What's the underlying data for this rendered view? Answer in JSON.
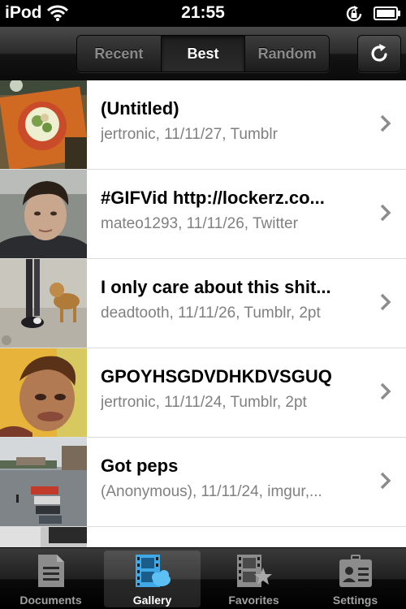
{
  "status_bar": {
    "carrier": "iPod",
    "time": "21:55"
  },
  "nav": {
    "segments": [
      "Recent",
      "Best",
      "Random"
    ],
    "selected_segment": "Best",
    "refresh_icon": "refresh-icon"
  },
  "list": {
    "rows": [
      {
        "title": "(Untitled)",
        "subtitle": "jertronic, 11/11/27, Tumblr",
        "thumb": "food-plate-photo"
      },
      {
        "title": "#GIFVid http://lockerz.co...",
        "subtitle": "mateo1293, 11/11/26, Twitter",
        "thumb": "face-photo"
      },
      {
        "title": "I only care about this shit...",
        "subtitle": "deadtooth, 11/11/26, Tumblr, 2pt",
        "thumb": "dogs-photo"
      },
      {
        "title": "GPOYHSGDVDHKDVSGUQ",
        "subtitle": "jertronic, 11/11/24, Tumblr, 2pt",
        "thumb": "distorted-face-photo"
      },
      {
        "title": "Got peps",
        "subtitle": "(Anonymous), 11/11/24, imgur,...",
        "thumb": "parking-lot-photo"
      },
      {
        "title": "",
        "subtitle": "",
        "thumb": "gray-photo"
      }
    ]
  },
  "tab_bar": {
    "tabs": [
      {
        "label": "Documents",
        "icon": "documents-icon"
      },
      {
        "label": "Gallery",
        "icon": "gallery-icon"
      },
      {
        "label": "Favorites",
        "icon": "favorites-icon"
      },
      {
        "label": "Settings",
        "icon": "settings-icon"
      }
    ],
    "selected_tab": "Gallery"
  },
  "colors": {
    "subtitle_gray": "#808080",
    "active_tab_blue": "#3fa9e8",
    "inactive_icon_gray": "#8c8c8c"
  }
}
